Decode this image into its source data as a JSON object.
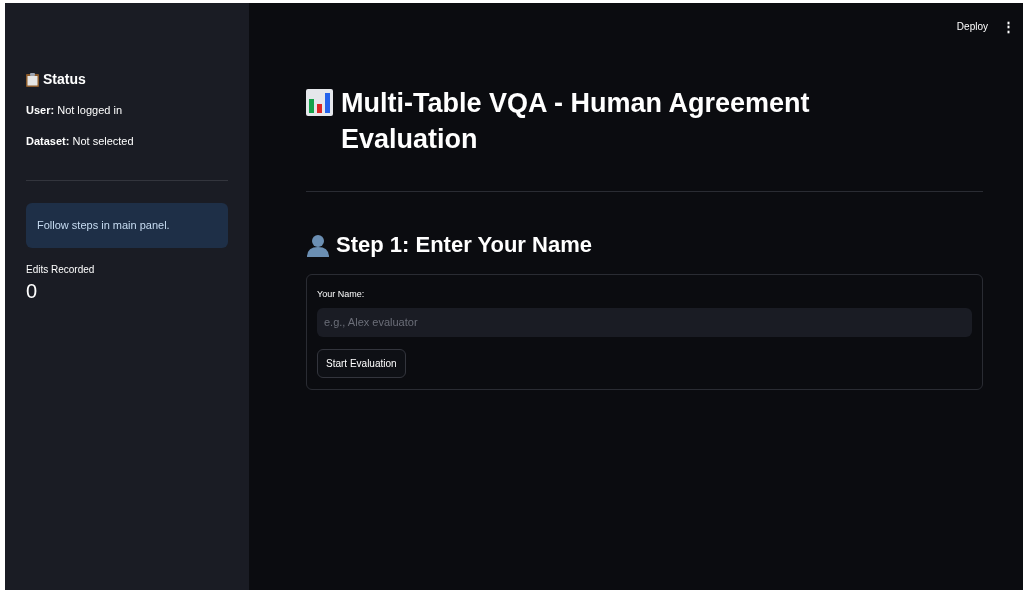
{
  "header": {
    "deploy": "Deploy",
    "menu": "⋮"
  },
  "sidebar": {
    "title": "Status",
    "lines": [
      "**User:** Not logged in",
      "**Dataset:** Not selected"
    ],
    "info": "Follow steps in main panel.",
    "metric": {
      "label": "Edits Recorded",
      "value": "0"
    }
  },
  "main": {
    "title": "Multi-Table VQA - Human Agreement Evaluation",
    "step_title": "Step 1: Enter Your Name",
    "form": {
      "label": "Your Name:",
      "placeholder": "e.g., Alex evaluator",
      "button": "Start Evaluation"
    }
  }
}
